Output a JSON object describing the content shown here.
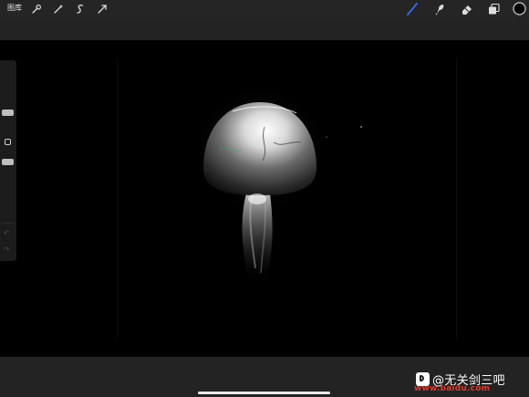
{
  "topbar": {
    "gallery_label": "图库",
    "left_tools": [
      "wrench-icon",
      "magic-wand-icon",
      "selection-icon",
      "transform-arrow-icon"
    ],
    "right_tools": [
      "brush-icon",
      "smudge-icon",
      "eraser-icon",
      "layers-icon",
      "color-swatch"
    ],
    "active_tool_color": "#2f6cf0",
    "current_color": "#000000"
  },
  "sidebar": {
    "controls": [
      "brush-size-slider",
      "modify-button",
      "opacity-slider",
      "undo-icon",
      "redo-icon"
    ]
  },
  "watermark": {
    "text": "@无关剑三吧",
    "url": "www.baidu.com"
  }
}
